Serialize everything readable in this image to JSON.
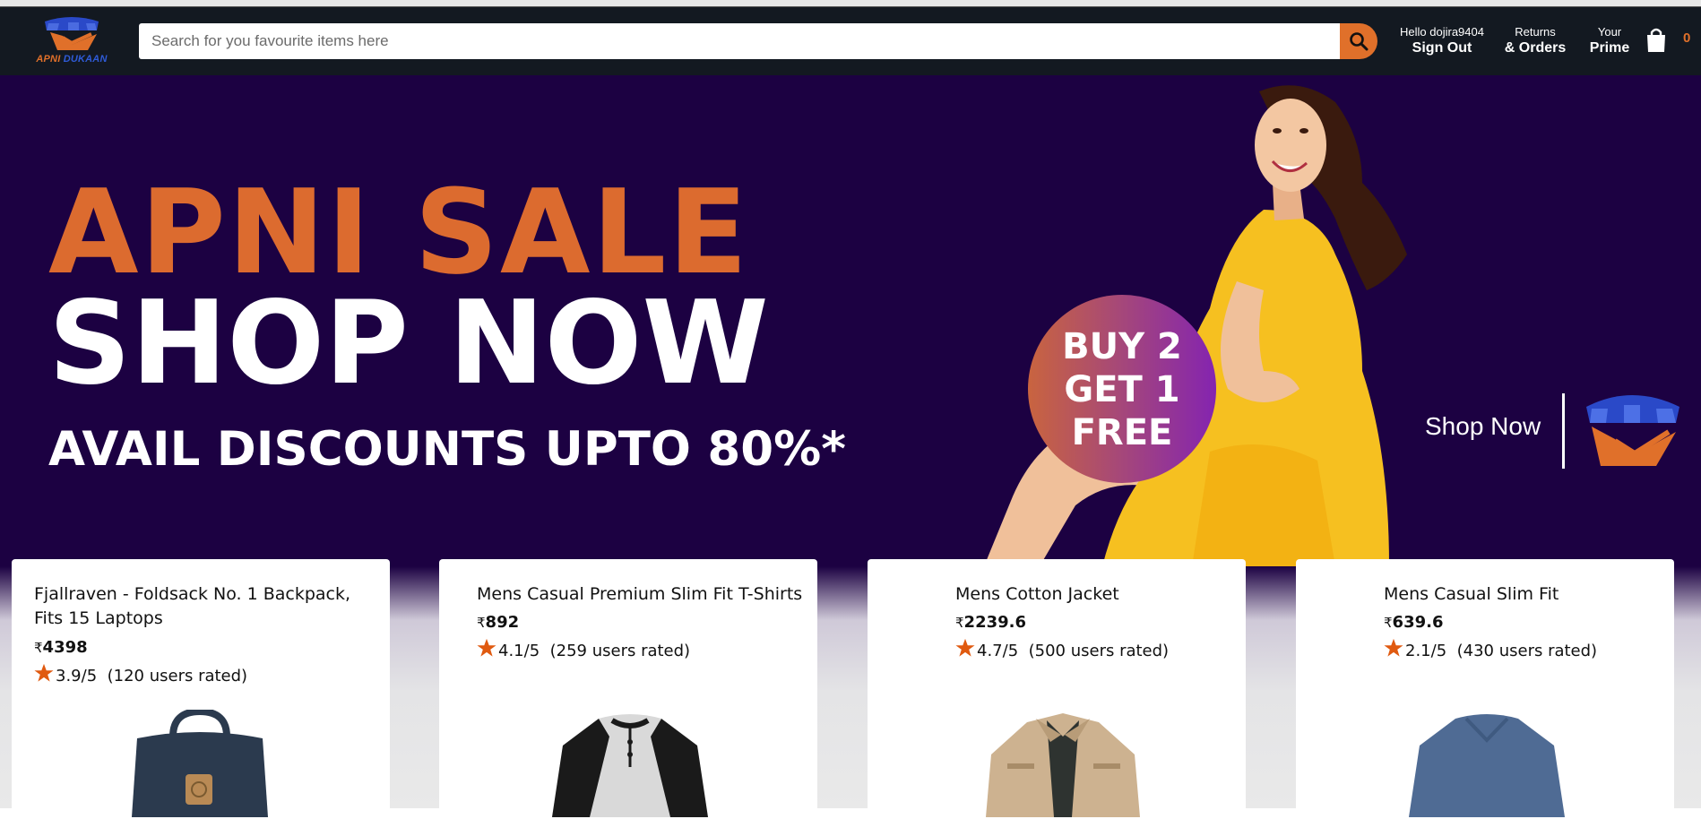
{
  "header": {
    "logo": {
      "word1": "APNI",
      "word2": "DUKAAN"
    },
    "search": {
      "placeholder": "Search for you favourite items here",
      "value": ""
    },
    "account": {
      "greeting": "Hello dojira9404",
      "action": "Sign Out"
    },
    "orders": {
      "line1": "Returns",
      "line2": "& Orders"
    },
    "prime": {
      "line1": "Your",
      "line2": "Prime"
    },
    "cart": {
      "count": "0"
    }
  },
  "hero": {
    "line1": "APNI SALE",
    "line2": "SHOP NOW",
    "line3": "AVAIL DISCOUNTS UPTO 80%*",
    "badge": [
      "BUY 2",
      "GET 1",
      "FREE"
    ],
    "cta": "Shop Now"
  },
  "products": [
    {
      "title": "Fjallraven - Foldsack No. 1 Backpack, Fits 15 Laptops",
      "currency": "₹",
      "price": "4398",
      "rating": "3.9/5",
      "rated": "(120 users rated)",
      "image": "backpack"
    },
    {
      "title": "Mens Casual Premium Slim Fit T-Shirts",
      "currency": "₹",
      "price": "892",
      "rating": "4.1/5",
      "rated": "(259 users rated)",
      "image": "raglan-tshirt"
    },
    {
      "title": "Mens Cotton Jacket",
      "currency": "₹",
      "price": "2239.6",
      "rating": "4.7/5",
      "rated": "(500 users rated)",
      "image": "jacket"
    },
    {
      "title": "Mens Casual Slim Fit",
      "currency": "₹",
      "price": "639.6",
      "rating": "2.1/5",
      "rated": "(430 users rated)",
      "image": "long-sleeve-tee"
    }
  ],
  "colors": {
    "header_bg": "#131921",
    "accent": "#e0702a",
    "hero_bg": "#1c0142",
    "star": "#e05a10"
  }
}
